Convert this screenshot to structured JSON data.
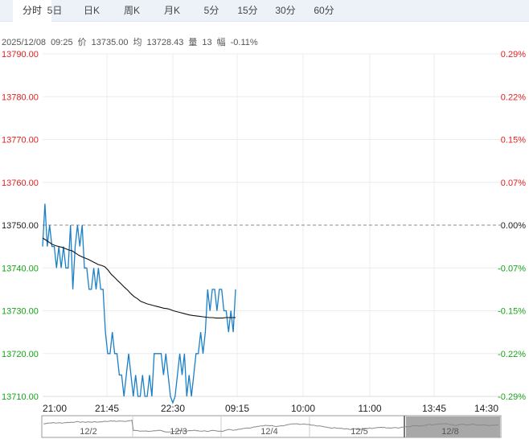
{
  "tabs": [
    "分时",
    "5日",
    "日K",
    "周K",
    "月K",
    "5分",
    "15分",
    "30分",
    "60分"
  ],
  "info": {
    "date": "2025/12/08",
    "time": "09:25",
    "price_label": "价",
    "price": "13735.00",
    "avg_label": "均",
    "avg": "13728.43",
    "vol_label": "量",
    "vol": "13",
    "chg_label": "幅",
    "chg": "-0.11%"
  },
  "colors": {
    "up": "#e02020",
    "down": "#16a316",
    "price_line": "#1a7fc8",
    "avg_line": "#111111"
  },
  "chart_data": {
    "type": "line",
    "ylim": [
      13710,
      13790
    ],
    "yticks": [
      "13790.00",
      "13780.00",
      "13770.00",
      "13760.00",
      "13750.00",
      "13740.00",
      "13730.00",
      "13720.00",
      "13710.00"
    ],
    "pct_ticks": [
      "0.29%",
      "0.22%",
      "0.15%",
      "0.07%",
      "0.00%",
      "-0.07%",
      "-0.15%",
      "-0.22%",
      "-0.29%"
    ],
    "prev_close": 13750,
    "xticks": [
      "21:00",
      "21:45",
      "22:30",
      "09:15",
      "10:00",
      "11:00",
      "13:45",
      "14:30"
    ],
    "series": [
      {
        "name": "price",
        "values": [
          13745,
          13755,
          13745,
          13750,
          13745,
          13745,
          13740,
          13745,
          13740,
          13745,
          13740,
          13740,
          13750,
          13735,
          13745,
          13750,
          13745,
          13750,
          13740,
          13740,
          13735,
          13735,
          13740,
          13735,
          13740,
          13735,
          13735,
          13725,
          13720,
          13720,
          13725,
          13720,
          13720,
          13715,
          13715,
          13710,
          13715,
          13720,
          13715,
          13710,
          13715,
          13710,
          13710,
          13715,
          13710,
          13710,
          13715,
          13710,
          13720,
          13720,
          13720,
          13720,
          13715,
          13720,
          13715,
          13710,
          13705,
          13710,
          13715,
          13720,
          13715,
          13720,
          13710,
          13715,
          13710,
          13715,
          13720,
          13720,
          13725,
          13720,
          13725,
          13735,
          13730,
          13735,
          13735,
          13730,
          13735,
          13735,
          13730,
          13730,
          13725,
          13730,
          13725,
          13735
        ]
      },
      {
        "name": "average",
        "values": [
          13747,
          13746.5,
          13746,
          13745.5,
          13745.2,
          13745,
          13744.8,
          13744.5,
          13744.2,
          13744,
          13743.5,
          13743,
          13742.6,
          13742.3,
          13742,
          13741.6,
          13741.2,
          13740.8,
          13740.6,
          13740.3,
          13739.5,
          13738.5,
          13737.8,
          13737,
          13736.3,
          13735.5,
          13734.8,
          13734,
          13733.3,
          13732.8,
          13732.2,
          13731.9,
          13731.6,
          13731.4,
          13731.2,
          13731,
          13730.8,
          13730.6,
          13730.5,
          13730.3,
          13730,
          13729.8,
          13729.6,
          13729.4,
          13729.2,
          13729,
          13728.9,
          13728.8,
          13728.7,
          13728.6,
          13728.5,
          13728.4,
          13728.4,
          13728.3,
          13728.3,
          13728.3,
          13728.4,
          13728.4,
          13728.4,
          13728.43
        ]
      }
    ],
    "navigator": {
      "labels": [
        "12/2",
        "12/3",
        "12/4",
        "12/5",
        "12/8"
      ],
      "selected": "12/8"
    }
  }
}
